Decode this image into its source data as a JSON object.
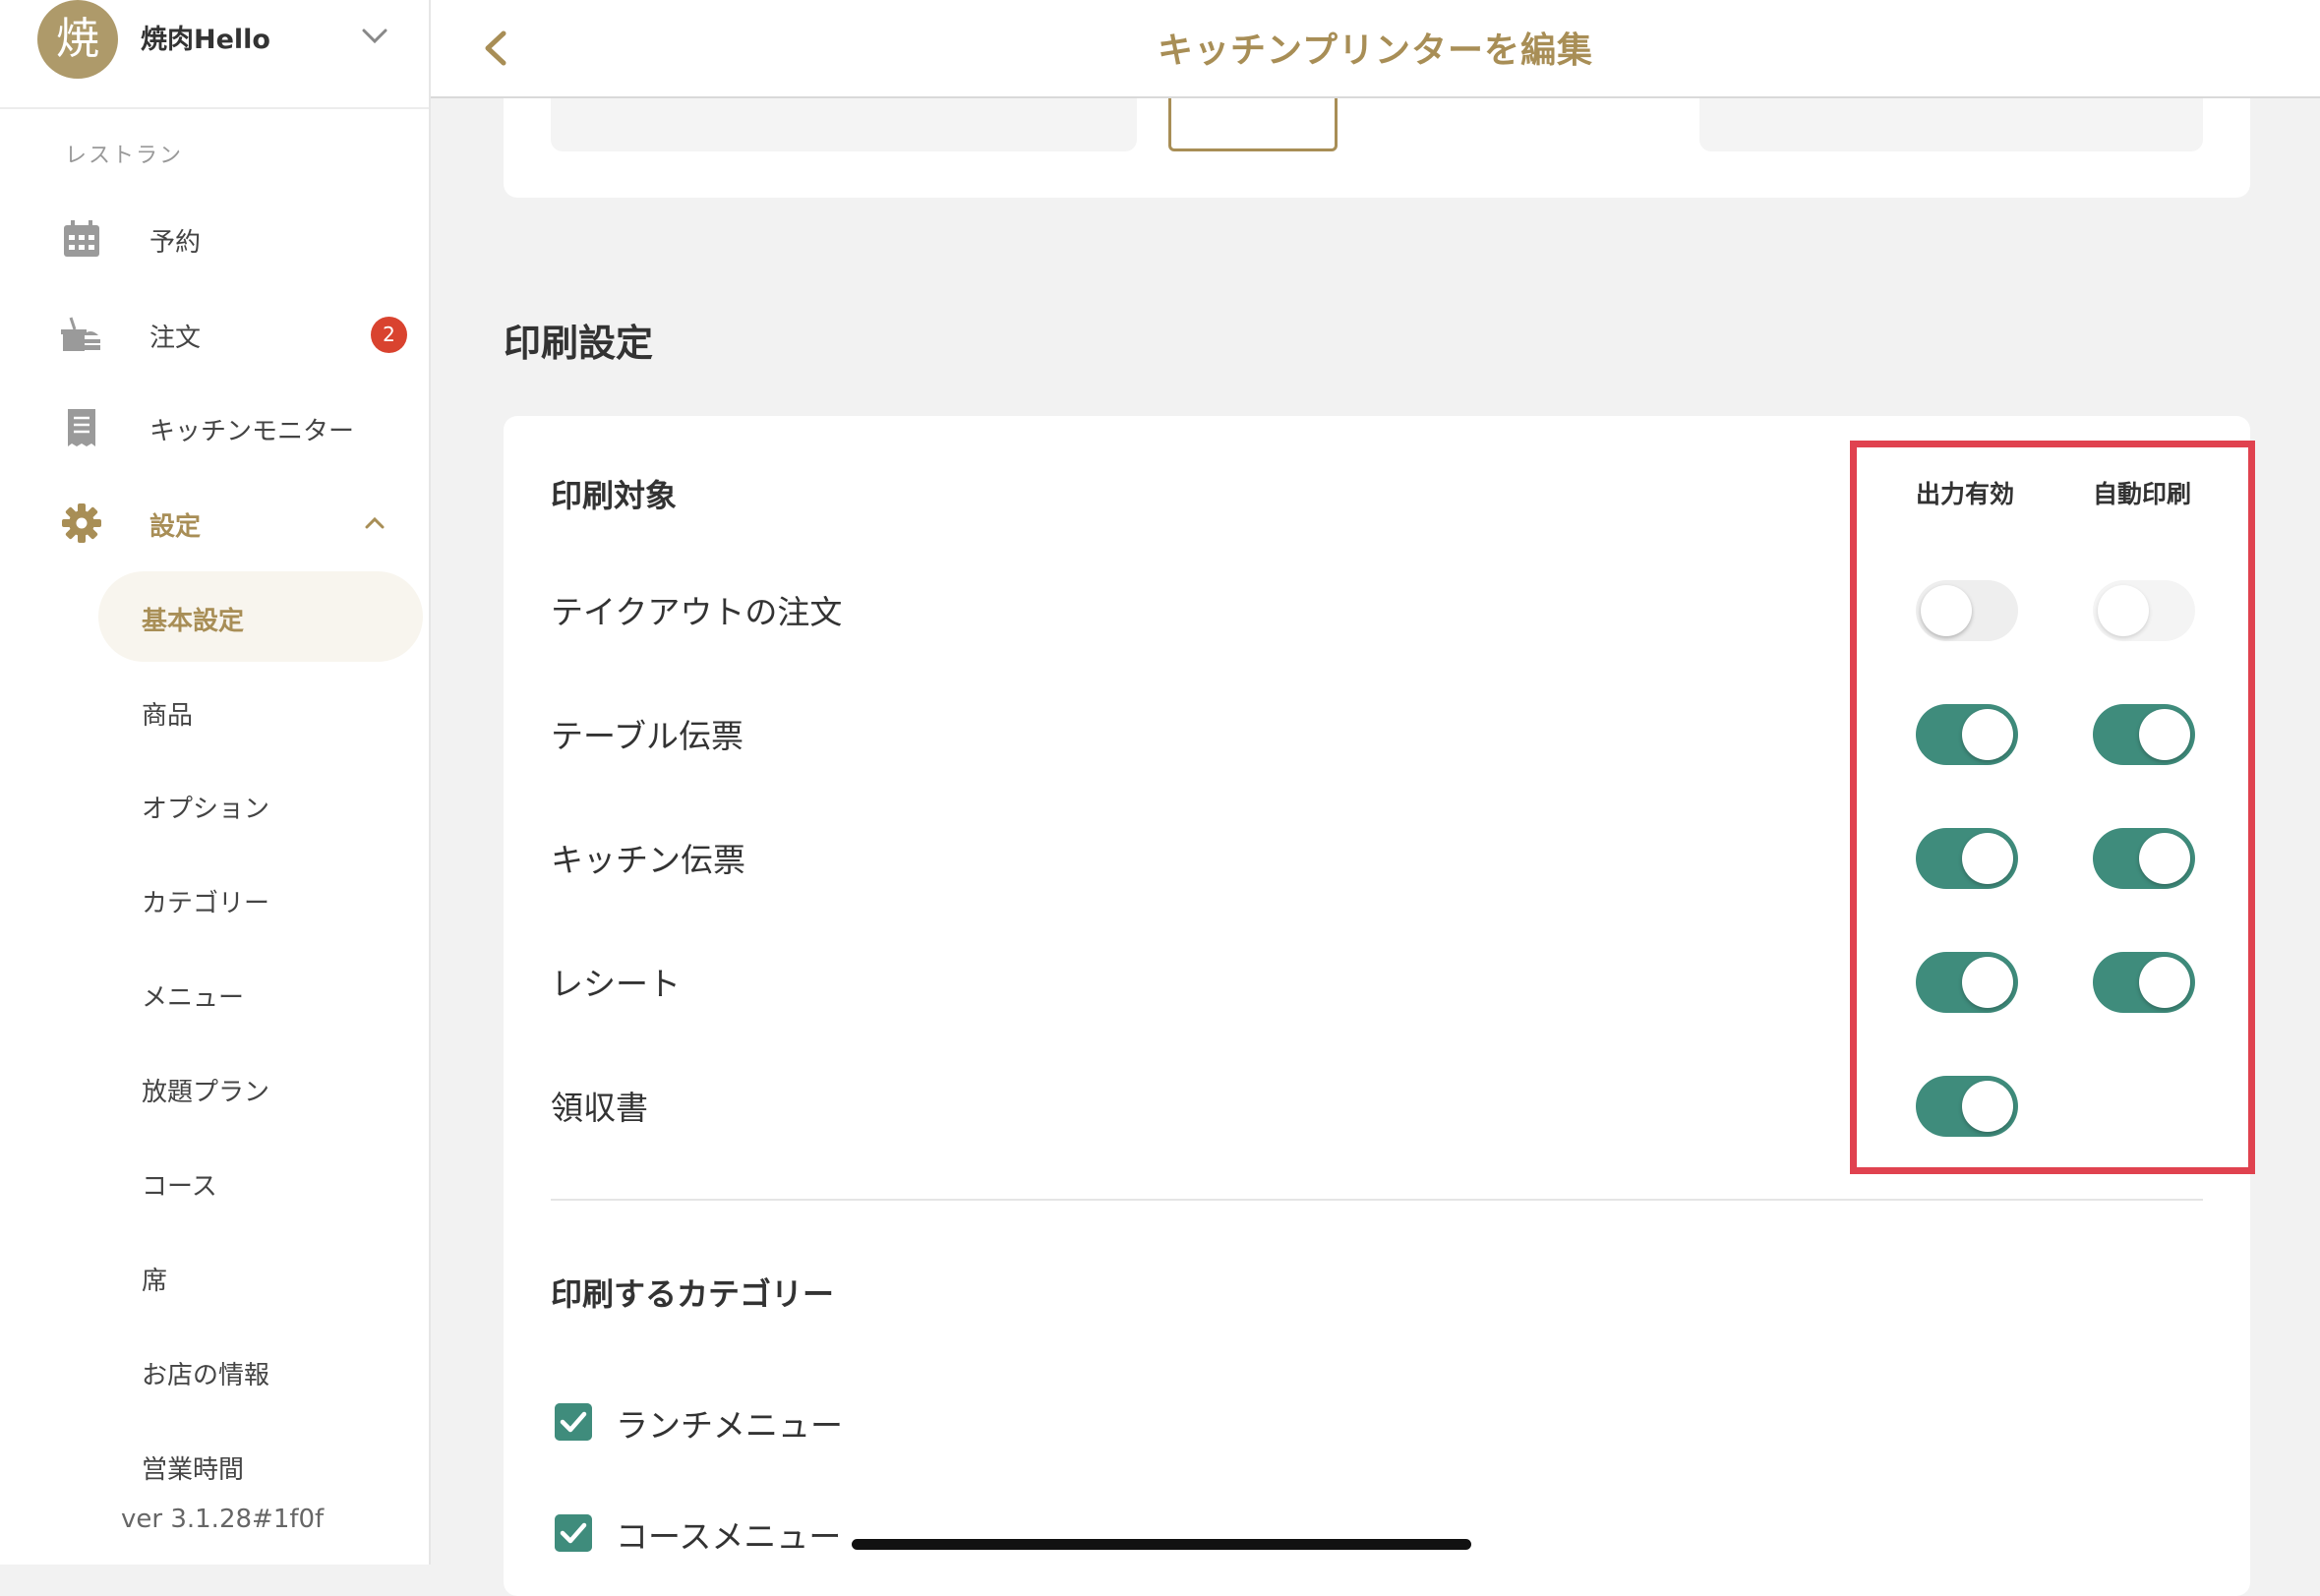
{
  "sidebar": {
    "avatar_char": "焼",
    "store_name": "焼肉Hello",
    "section_label": "レストラン",
    "nav": {
      "reservation": "予約",
      "orders": "注文",
      "orders_badge": "2",
      "kitchen_monitor": "キッチンモニター",
      "settings": "設定"
    },
    "sub_items": [
      "基本設定",
      "商品",
      "オプション",
      "カテゴリー",
      "メニュー",
      "放題プラン",
      "コース",
      "席",
      "お店の情報",
      "営業時間"
    ],
    "active_sub": "基本設定",
    "version": "ver 3.1.28#1f0f"
  },
  "topbar": {
    "title": "キッチンプリンターを編集"
  },
  "print_settings": {
    "section_title": "印刷設定",
    "card_heading": "印刷対象",
    "columns": [
      "出力有効",
      "自動印刷"
    ],
    "rows": [
      {
        "label": "テイクアウトの注文",
        "output_enabled": false,
        "auto_print": false
      },
      {
        "label": "テーブル伝票",
        "output_enabled": true,
        "auto_print": true
      },
      {
        "label": "キッチン伝票",
        "output_enabled": true,
        "auto_print": true
      },
      {
        "label": "レシート",
        "output_enabled": true,
        "auto_print": true
      },
      {
        "label": "領収書",
        "output_enabled": true,
        "auto_print": null
      }
    ],
    "category_heading": "印刷するカテゴリー",
    "categories": [
      {
        "label": "ランチメニュー",
        "checked": true
      },
      {
        "label": "コースメニュー",
        "checked": true
      }
    ]
  },
  "colors": {
    "accent_gold": "#a88e56",
    "toggle_on": "#3f8c7c",
    "highlight_red": "#e0424f",
    "badge_red": "#d9432f"
  }
}
